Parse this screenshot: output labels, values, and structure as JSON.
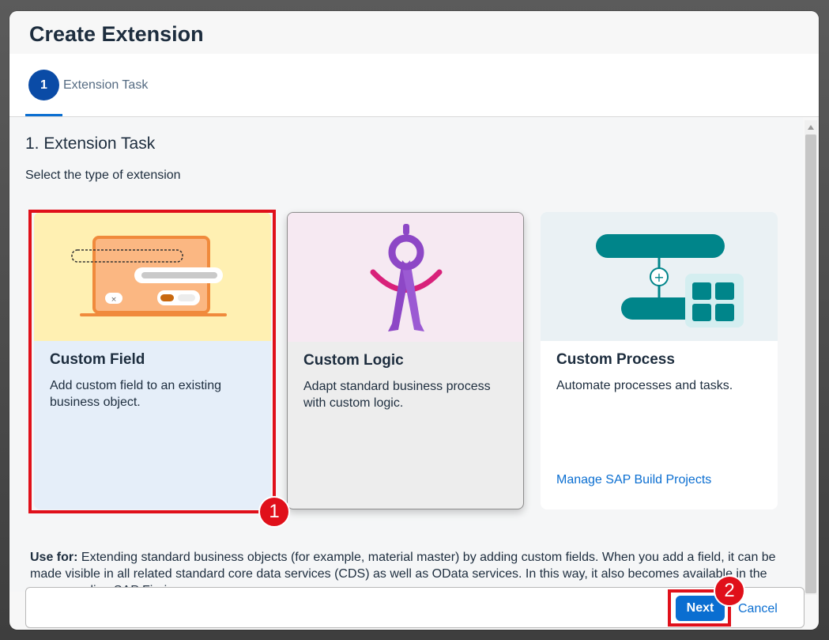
{
  "dialog": {
    "title": "Create Extension"
  },
  "wizard": {
    "steps": [
      {
        "number": "1",
        "label": "Extension Task"
      }
    ]
  },
  "section": {
    "title": "1. Extension Task",
    "subtitle": "Select the type of extension"
  },
  "cards": [
    {
      "title": "Custom Field",
      "description": "Add custom field to an existing business object.",
      "image": "laptop-form-illustration"
    },
    {
      "title": "Custom Logic",
      "description": "Adapt standard business process with custom logic.",
      "image": "compass-illustration"
    },
    {
      "title": "Custom Process",
      "description": "Automate processes and tasks.",
      "link": "Manage SAP Build Projects",
      "image": "process-flow-illustration"
    }
  ],
  "use_for": {
    "label": "Use for:",
    "text": " Extending standard business objects (for example, material master) by adding custom fields. When you add a field, it can be made visible in all related standard core data services (CDS) as well as OData services. In this way, it also becomes available in the corresponding SAP Fiori apps."
  },
  "footer": {
    "next_label": "Next",
    "cancel_label": "Cancel"
  },
  "annotations": {
    "badge_1": "1",
    "badge_2": "2"
  },
  "colors": {
    "accent": "#0a6ed1",
    "highlight": "#e0101a",
    "step_active": "#0a4ba6"
  }
}
